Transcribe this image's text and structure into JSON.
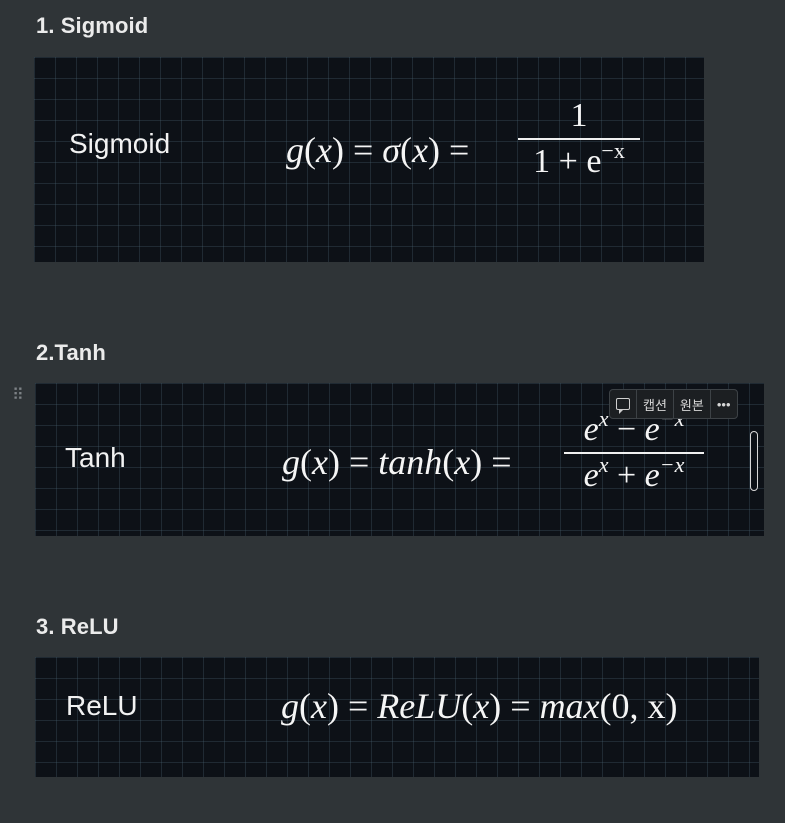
{
  "sections": [
    {
      "heading": "1. Sigmoid",
      "name": "Sigmoid",
      "lhs_g": "g",
      "lhs_mid": "σ",
      "numerator": "1",
      "den_base": "1 + e",
      "den_exp": "−x"
    },
    {
      "heading": "2.Tanh",
      "name": "Tanh",
      "lhs_g": "g",
      "lhs_mid": "tanh",
      "num_base1": "e",
      "num_exp1": "x",
      "num_op": " − ",
      "num_base2": "e",
      "num_exp2": "−x",
      "den_base1": "e",
      "den_exp1": "x",
      "den_op": " + ",
      "den_base2": "e",
      "den_exp2": "−x"
    },
    {
      "heading": "3. ReLU",
      "name": "ReLU",
      "lhs_g": "g",
      "mid": "ReLU",
      "rhs_fn": "max",
      "rhs_args": "(0, x)"
    }
  ],
  "toolbar": {
    "caption_label": "캡션",
    "original_label": "원본",
    "more_label": "•••",
    "comment_icon": "comment-icon"
  },
  "drag_handle_icon": "drag-handle-icon"
}
